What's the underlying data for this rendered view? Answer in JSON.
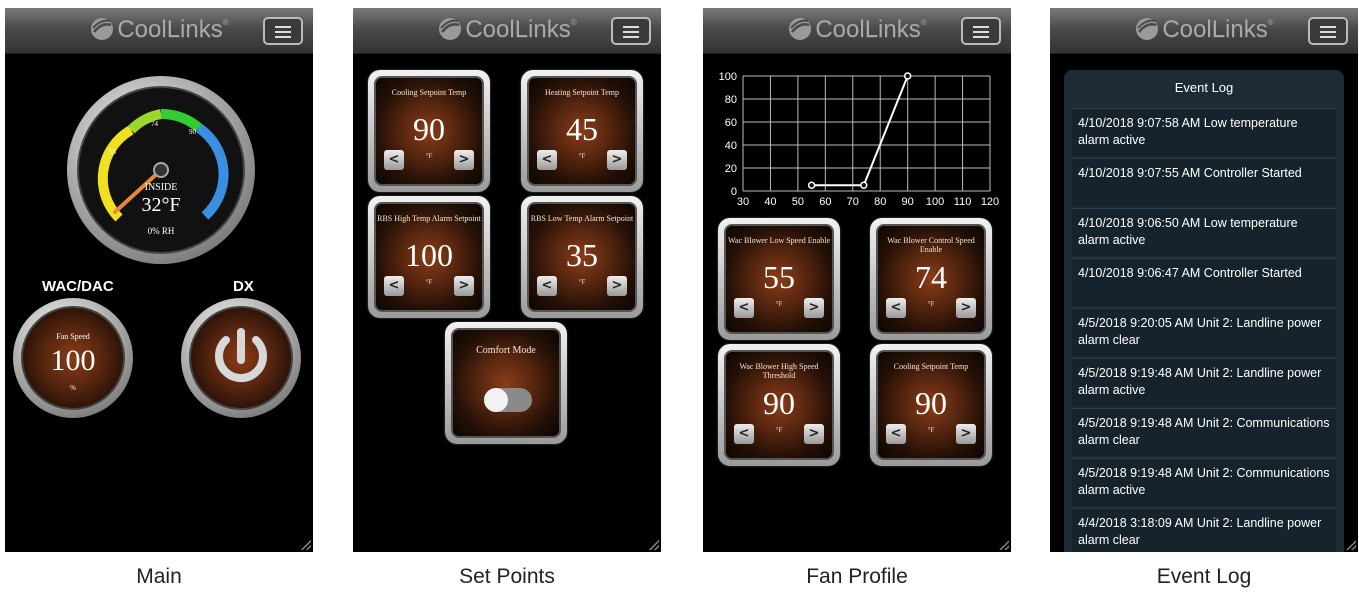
{
  "app": {
    "logo_text": "CoolLinks",
    "logo_mark": "®"
  },
  "colors": {
    "tile_bg": "#5a2710",
    "log_bg": "#1d2b36",
    "gauge_yellow": "#f0e020",
    "gauge_green": "#33cc33",
    "gauge_blue": "#3a8fe0",
    "needle": "#e08a3a"
  },
  "captions": [
    "Main",
    "Set Points",
    "Fan Profile",
    "Event Log"
  ],
  "main": {
    "gauge": {
      "ticks": [
        "55",
        "74",
        "90"
      ],
      "label": "INSIDE",
      "temperature": "32°F",
      "humidity": "0% RH",
      "needle_value_f": 32
    },
    "wac_label": "WAC/DAC",
    "dx_label": "DX",
    "fan_speed": {
      "title": "Fan Speed",
      "value": "100",
      "unit": "%"
    }
  },
  "set_points": {
    "tiles": [
      {
        "title": "Cooling Setpoint Temp",
        "value": "90",
        "unit": "°F"
      },
      {
        "title": "Heating Setpoint Temp",
        "value": "45",
        "unit": "°F"
      },
      {
        "title": "RBS High Temp Alarm Setpoint",
        "value": "100",
        "unit": "°F"
      },
      {
        "title": "RBS Low Temp Alarm Setpoint",
        "value": "35",
        "unit": "°F"
      }
    ],
    "comfort_mode": {
      "title": "Comfort Mode",
      "state": "off"
    }
  },
  "fan_profile": {
    "chart_data": {
      "type": "line",
      "x": [
        55,
        74,
        90
      ],
      "y": [
        5,
        5,
        100
      ],
      "xlim": [
        30,
        120
      ],
      "ylim": [
        0,
        100
      ],
      "xticks": [
        "30",
        "40",
        "50",
        "60",
        "70",
        "80",
        "90",
        "100",
        "110",
        "120"
      ],
      "yticks": [
        "0",
        "20",
        "40",
        "60",
        "80",
        "100"
      ],
      "grid": true
    },
    "tiles": [
      {
        "title": "Wac Blower Low Speed Enable",
        "value": "55",
        "unit": "°F"
      },
      {
        "title": "Wac Blower Control Speed Enable",
        "value": "74",
        "unit": "°F"
      },
      {
        "title": "Wac Blower High Speed Threshold",
        "value": "90",
        "unit": "°F"
      },
      {
        "title": "Cooling Setpoint Temp",
        "value": "90",
        "unit": "°F"
      }
    ]
  },
  "event_log": {
    "title": "Event Log",
    "items": [
      "4/10/2018 9:07:58 AM Low temperature alarm active",
      "4/10/2018 9:07:55 AM Controller Started",
      "4/10/2018 9:06:50 AM Low temperature alarm active",
      "4/10/2018 9:06:47 AM Controller Started",
      "4/5/2018 9:20:05 AM Unit 2: Landline power alarm clear",
      "4/5/2018 9:19:48 AM Unit 2: Landline power alarm active",
      "4/5/2018 9:19:48 AM Unit 2: Communications alarm clear",
      "4/5/2018 9:19:48 AM Unit 2: Communications alarm active",
      "4/4/2018 3:18:09 AM Unit 2: Landline power alarm clear"
    ]
  }
}
